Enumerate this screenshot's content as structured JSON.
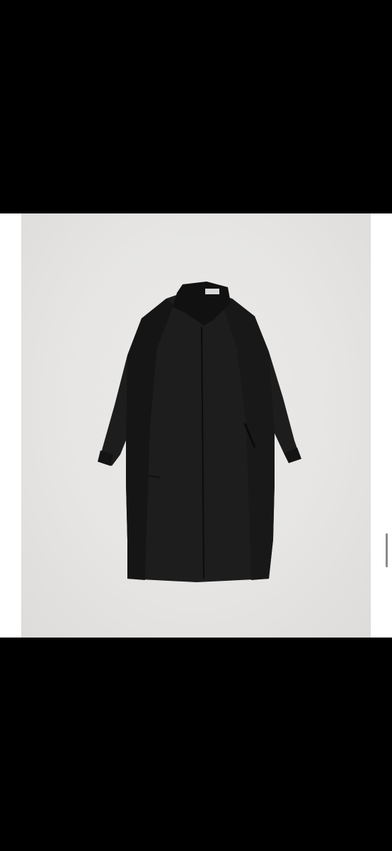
{
  "viewer": {
    "background_color": "#000000",
    "frame_color": "#ffffff",
    "backdrop_color": "#e6e5e3"
  },
  "photo": {
    "subject_icon": "coat-icon",
    "coat_color": "#1c1c1c"
  }
}
